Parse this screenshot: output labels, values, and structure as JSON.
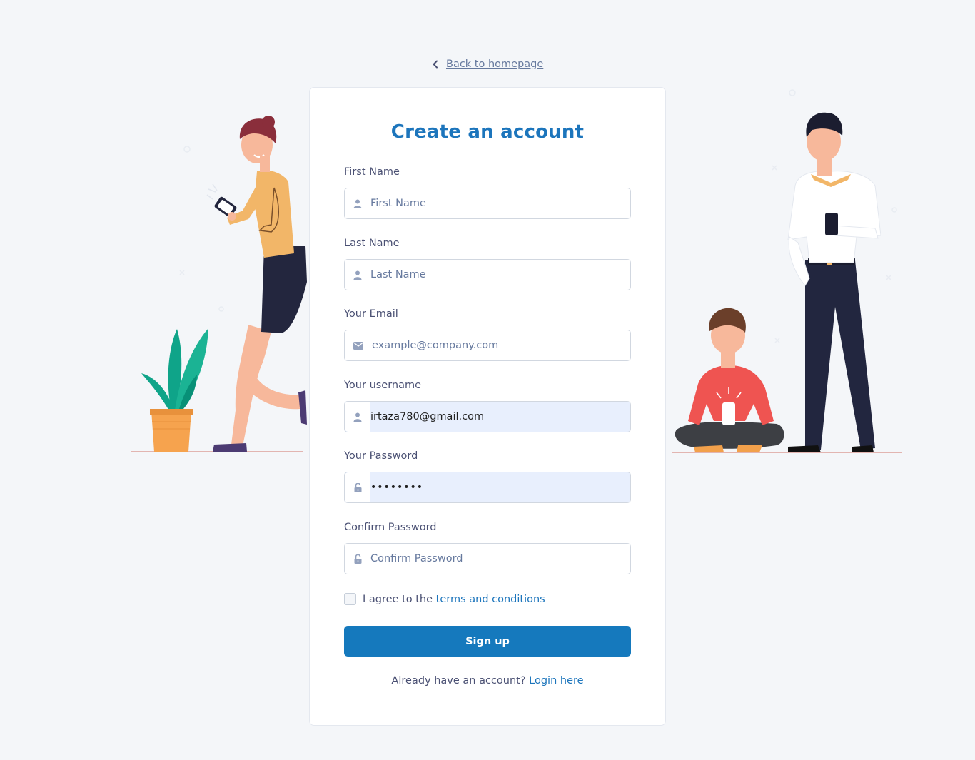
{
  "back_link": {
    "label": "Back to homepage",
    "icon": "chevron-left-icon"
  },
  "form": {
    "title": "Create an account",
    "fields": {
      "first_name": {
        "label": "First Name",
        "placeholder": "First Name",
        "value": "",
        "icon": "user-icon"
      },
      "last_name": {
        "label": "Last Name",
        "placeholder": "Last Name",
        "value": "",
        "icon": "user-icon"
      },
      "email": {
        "label": "Your Email",
        "placeholder": "example@company.com",
        "value": "",
        "icon": "envelope-icon"
      },
      "username": {
        "label": "Your username",
        "placeholder": "",
        "value": "irtaza780@gmail.com",
        "icon": "user-icon"
      },
      "password": {
        "label": "Your Password",
        "placeholder": "",
        "value": "••••••••",
        "icon": "unlock-icon"
      },
      "confirm_password": {
        "label": "Confirm Password",
        "placeholder": "Confirm Password",
        "value": "",
        "icon": "unlock-icon"
      }
    },
    "agree": {
      "prefix": "I agree to the",
      "link": "terms and conditions",
      "checked": false
    },
    "submit_label": "Sign up",
    "login_prompt": "Already have an account?",
    "login_link": "Login here"
  },
  "colors": {
    "accent": "#1c75bc",
    "button": "#1579bd",
    "background": "#f4f6f9",
    "autofill": "#e8effd"
  }
}
